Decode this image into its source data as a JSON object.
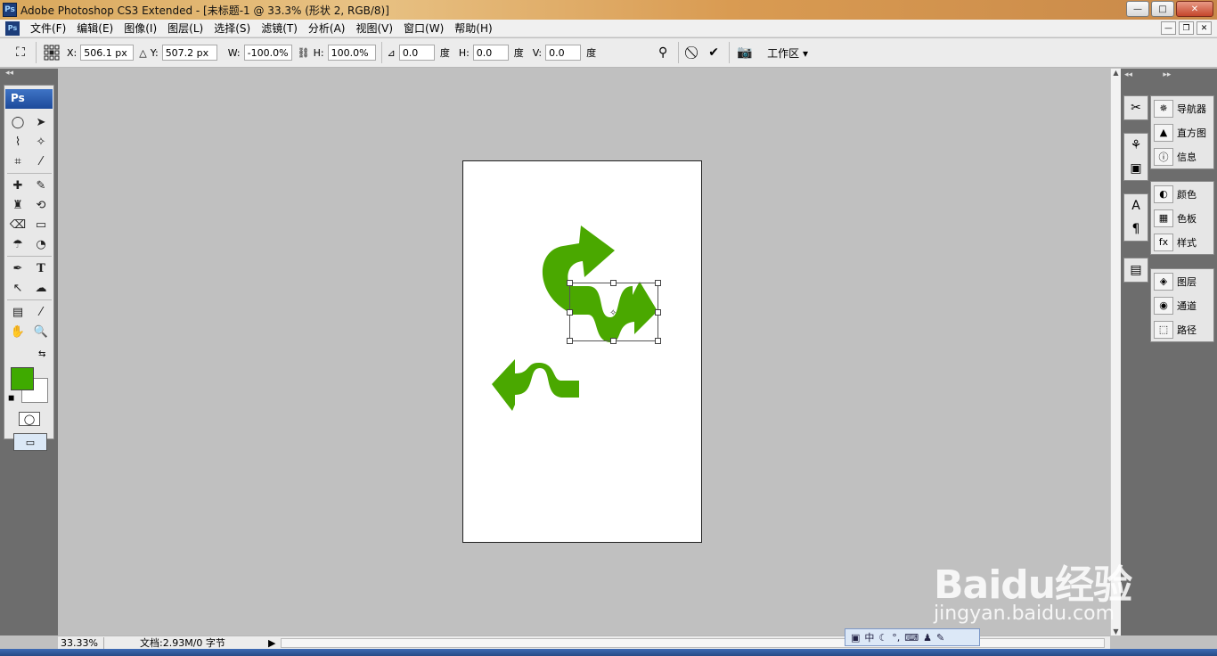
{
  "window": {
    "title": "Adobe Photoshop CS3 Extended - [未标题-1 @ 33.3% (形状 2, RGB/8)]",
    "app_icon": "Ps",
    "buttons": {
      "minimize": "—",
      "maximize": "□",
      "close": "✕"
    }
  },
  "menubar": {
    "items": [
      "文件(F)",
      "编辑(E)",
      "图像(I)",
      "图层(L)",
      "选择(S)",
      "滤镜(T)",
      "分析(A)",
      "视图(V)",
      "窗口(W)",
      "帮助(H)"
    ],
    "doc_buttons": [
      "—",
      "❐",
      "✕"
    ]
  },
  "options": {
    "x_label": "X:",
    "x_value": "506.1 px",
    "y_label": "Y:",
    "y_value": "507.2 px",
    "w_label": "W:",
    "w_value": "-100.0%",
    "h_label": "H:",
    "h_value": "100.0%",
    "angle_value": "0.0",
    "angle_unit": "度",
    "hskew_label": "H:",
    "hskew_value": "0.0",
    "hskew_unit": "度",
    "vskew_label": "V:",
    "vskew_value": "0.0",
    "vskew_unit": "度",
    "workspace_label": "工作区 ▾"
  },
  "toolbox": {
    "logo": "Ps",
    "tools": [
      "marquee-icon",
      "move-icon",
      "lasso-icon",
      "magic-wand-icon",
      "crop-icon",
      "slice-icon",
      "healing-icon",
      "brush-icon",
      "stamp-icon",
      "history-brush-icon",
      "eraser-icon",
      "gradient-icon",
      "blur-icon",
      "dodge-icon",
      "pen-icon",
      "type-icon",
      "path-select-icon",
      "shape-icon",
      "notes-icon",
      "eyedropper-icon",
      "hand-icon",
      "zoom-icon"
    ],
    "foreground_color": "#3faa00",
    "background_color": "#ffffff"
  },
  "right_panels": {
    "group1": [
      "导航器",
      "直方图",
      "信息"
    ],
    "group2": [
      "颜色",
      "色板",
      "样式"
    ],
    "group3": [
      "图层",
      "通道",
      "路径"
    ]
  },
  "status": {
    "zoom": "33.33%",
    "docinfo": "文档:2.93M/0 字节"
  },
  "ime": {
    "label": "中"
  },
  "watermark": {
    "brand": "Baidu经验",
    "url": "jingyan.baidu.com"
  },
  "colors": {
    "shape_green": "#4aa800"
  }
}
